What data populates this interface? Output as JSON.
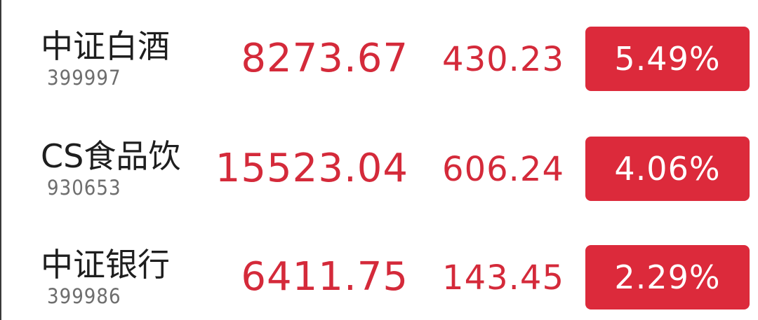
{
  "colors": {
    "rise_text": "#d42a3a",
    "rise_badge": "#dc2a3b",
    "name_text": "#1e1e1e",
    "code_text": "#6e6e6e"
  },
  "rows": [
    {
      "name": "中证白酒",
      "code": "399997",
      "price": "8273.67",
      "change": "430.23",
      "change_pct": "5.49%"
    },
    {
      "name": "CS食品饮",
      "code": "930653",
      "price": "15523.04",
      "change": "606.24",
      "change_pct": "4.06%"
    },
    {
      "name": "中证银行",
      "code": "399986",
      "price": "6411.75",
      "change": "143.45",
      "change_pct": "2.29%"
    }
  ]
}
